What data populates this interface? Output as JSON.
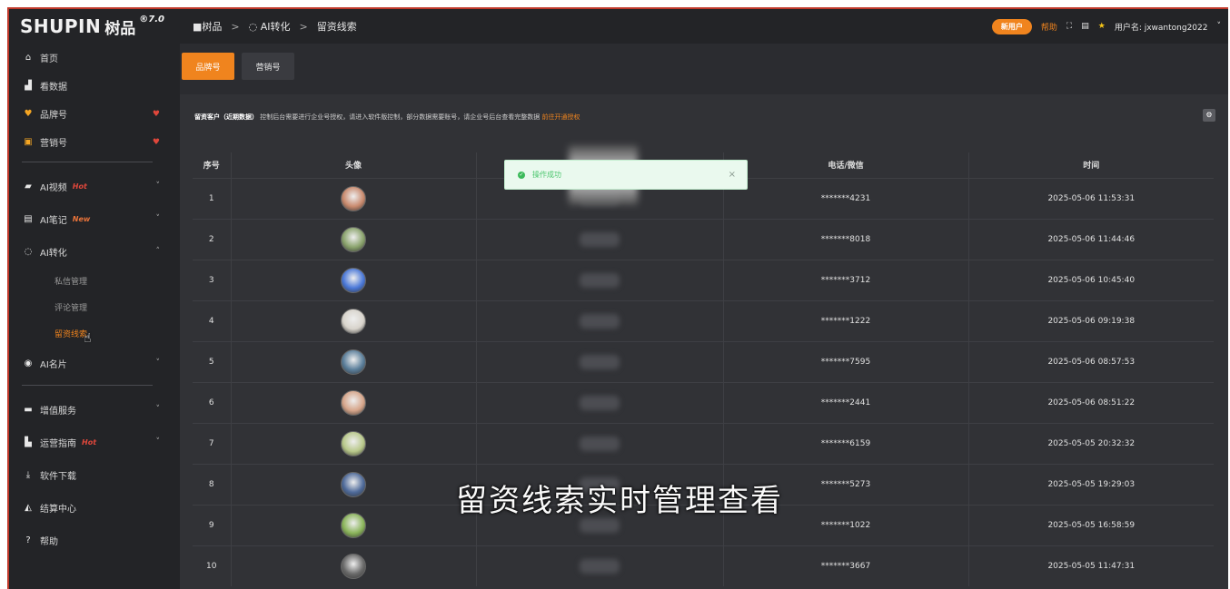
{
  "brand": {
    "logo_text": "SHUPIN",
    "logo_cn": "树品",
    "version": "®7.0"
  },
  "sidebar": {
    "items": [
      {
        "label": "首页",
        "icon": "home-icon",
        "glyph": "⌂"
      },
      {
        "label": "看数据",
        "icon": "bar-chart-icon",
        "glyph": "▟"
      },
      {
        "label": "品牌号",
        "icon": "brand-icon",
        "glyph": "♥",
        "right": "♥"
      },
      {
        "label": "营销号",
        "icon": "marketing-icon",
        "glyph": "▣",
        "right": "♥"
      },
      {
        "label": "AI视频",
        "icon": "video-icon",
        "glyph": "▰",
        "badge": "Hot",
        "right": "˅"
      },
      {
        "label": "AI笔记",
        "icon": "note-icon",
        "glyph": "▤",
        "badge": "New",
        "right": "˅"
      },
      {
        "label": "AI转化",
        "icon": "convert-icon",
        "glyph": "◌",
        "right": "˄"
      },
      {
        "label": "AI名片",
        "icon": "card-icon",
        "glyph": "◉",
        "right": "˅"
      },
      {
        "label": "增值服务",
        "icon": "service-icon",
        "glyph": "▬",
        "right": "˅"
      },
      {
        "label": "运营指南",
        "icon": "guide-icon",
        "glyph": "▙",
        "badge": "Hot",
        "right": "˅"
      },
      {
        "label": "软件下载",
        "icon": "download-icon",
        "glyph": "⤓"
      },
      {
        "label": "结算中心",
        "icon": "settlement-icon",
        "glyph": "◭"
      },
      {
        "label": "帮助",
        "icon": "help-icon",
        "glyph": "?"
      }
    ],
    "sub_items": [
      {
        "label": "私信管理"
      },
      {
        "label": "评论管理"
      },
      {
        "label": "留资线索"
      }
    ]
  },
  "header": {
    "breadcrumb": [
      "树品",
      "AI转化",
      "留资线索"
    ],
    "crumb_sep": ">",
    "pill_label": "新用户",
    "help_label": "帮助",
    "user_label": "用户名: jxwantong2022",
    "fullscreen_glyph": "⛶",
    "doc_glyph": "▤",
    "star_glyph": "★",
    "dropdown_glyph": "˅"
  },
  "tabs": [
    {
      "label": "品牌号",
      "active": true
    },
    {
      "label": "营销号",
      "active": false
    }
  ],
  "notice": {
    "title": "留资客户（近期数据）",
    "body": "控制后台需要进行企业号授权，请进入软件版控制，部分数据需要账号，请企业号后台查看完整数据",
    "link": "前往开通授权"
  },
  "table": {
    "headers": [
      "序号",
      "头像",
      "",
      "电话/微信",
      "时间"
    ],
    "rows": [
      {
        "idx": "1",
        "phone": "*******4231",
        "time": "2025-05-06 11:53:31",
        "color": "#c98a6e"
      },
      {
        "idx": "2",
        "phone": "*******8018",
        "time": "2025-05-06 11:44:46",
        "color": "#8aa36c"
      },
      {
        "idx": "3",
        "phone": "*******3712",
        "time": "2025-05-06 10:45:40",
        "color": "#4a78d8"
      },
      {
        "idx": "4",
        "phone": "*******1222",
        "time": "2025-05-06 09:19:38",
        "color": "#d8d4cc"
      },
      {
        "idx": "5",
        "phone": "*******7595",
        "time": "2025-05-06 08:57:53",
        "color": "#5a7e9a"
      },
      {
        "idx": "6",
        "phone": "*******2441",
        "time": "2025-05-06 08:51:22",
        "color": "#d6a58a"
      },
      {
        "idx": "7",
        "phone": "*******6159",
        "time": "2025-05-05 20:32:32",
        "color": "#b8c88a"
      },
      {
        "idx": "8",
        "phone": "*******5273",
        "time": "2025-05-05 19:29:03",
        "color": "#4e6a9a"
      },
      {
        "idx": "9",
        "phone": "*******1022",
        "time": "2025-05-05 16:58:59",
        "color": "#8ab45a"
      },
      {
        "idx": "10",
        "phone": "*******3667",
        "time": "2025-05-05 11:47:31",
        "color": "#6a6a6a"
      }
    ]
  },
  "toast": {
    "text": "操作成功",
    "close": "×"
  },
  "caption": "留资线索实时管理查看",
  "colors": {
    "accent": "#f0841e",
    "sidebar": "#232427",
    "panel": "#313236"
  }
}
